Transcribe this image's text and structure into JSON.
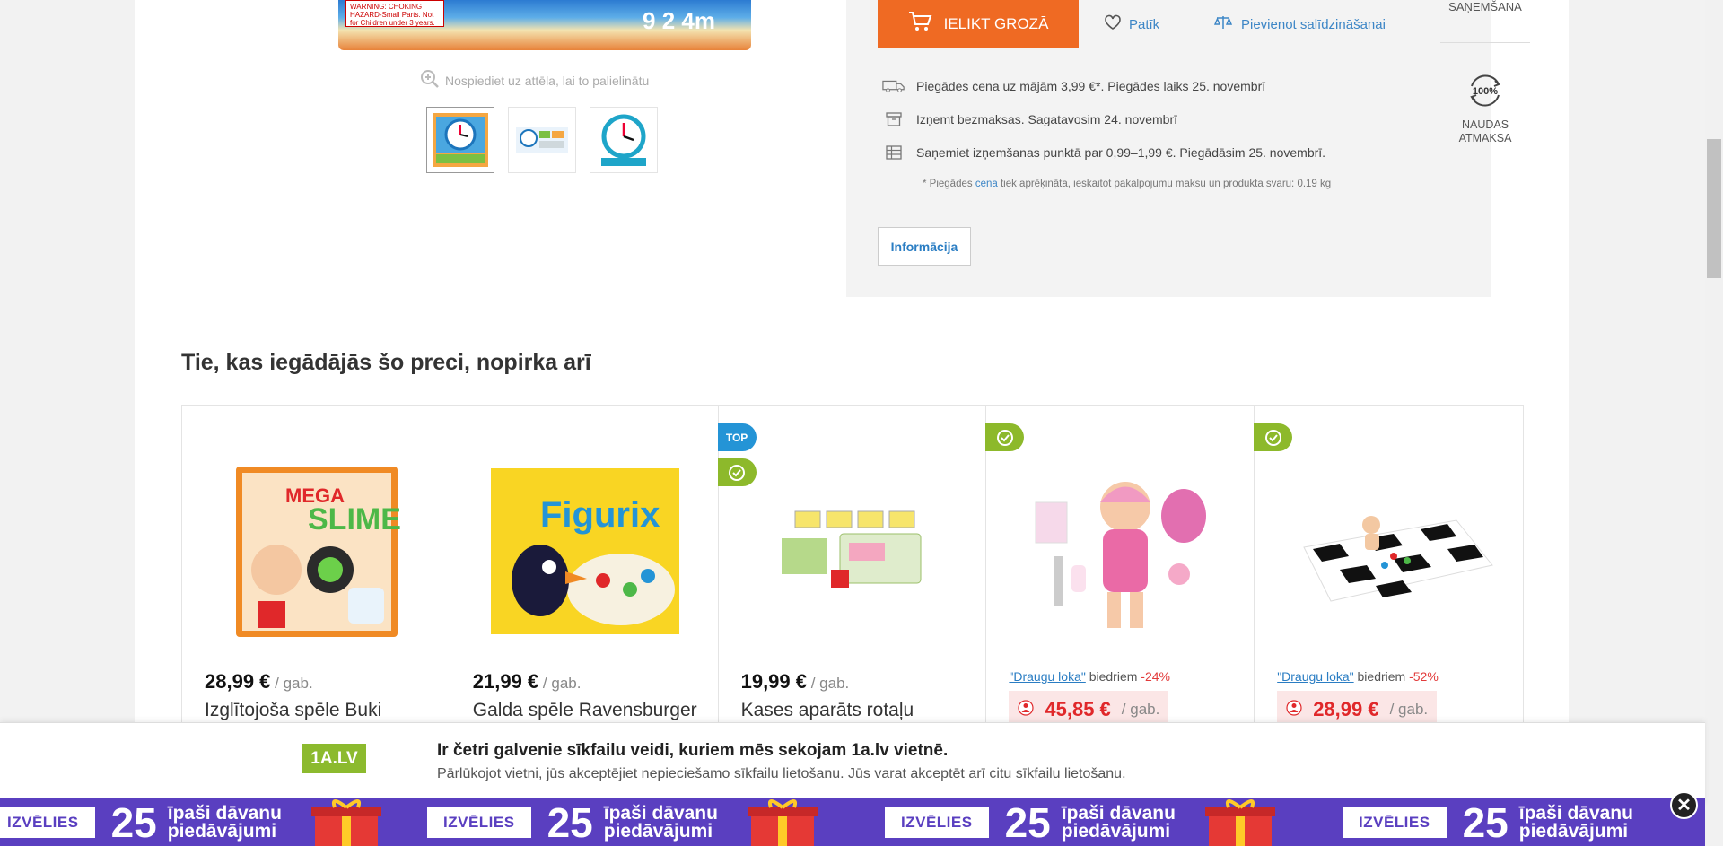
{
  "gallery": {
    "zoom_hint": "Nospiediet uz attēla, lai to palielinātu",
    "warning_text": "WARNING: CHOKING HAZARD-Small Parts. Not for Children under 3 years.",
    "numbers": "9 2 4m",
    "thumbnails": [
      "clock-box-front",
      "clock-box-contents",
      "clock-face"
    ]
  },
  "buy_box": {
    "cart_button": "IELIKT GROZĀ",
    "like_link": "Patīk",
    "compare_link": "Pievienot salīdzināšanai",
    "delivery": [
      {
        "icon": "truck-icon",
        "text": "Piegādes cena uz mājām 3,99 €*. Piegādes laiks 25. novembrī"
      },
      {
        "icon": "box-icon",
        "text": "Izņemt bezmaksas. Sagatavosim 24. novembrī"
      },
      {
        "icon": "parcel-locker-icon",
        "text": "Saņemiet izņemšanas punktā par 0,99–1,99 €. Piegādāsim 25. novembrī."
      }
    ],
    "note_prefix": "* Piegādes ",
    "note_link": "cena",
    "note_suffix": " tiek aprēķināta, ieskaitot pakalpojumu maksu un produkta svaru: 0.19 kg",
    "info_button": "Informācija"
  },
  "right_col": {
    "top_label": "SAŅEMŠANA",
    "refund_percent": "100%",
    "refund_line1": "NAUDAS",
    "refund_line2": "ATMAKSA"
  },
  "section": {
    "title": "Tie, kas iegādājās šo preci, nopirka arī"
  },
  "products": [
    {
      "price": "28,99 €",
      "unit": " / gab.",
      "name": "Izglītojoša spēle Buki",
      "badges": []
    },
    {
      "price": "21,99 €",
      "unit": " / gab.",
      "name": "Galda spēle Ravensburger",
      "badges": []
    },
    {
      "price": "19,99 €",
      "unit": " / gab.",
      "name": "Kases aparāts rotaļu",
      "badges": [
        "TOP",
        "check"
      ]
    },
    {
      "friends_link": "\"Draugu loka\"",
      "friends_text": " biedriem ",
      "discount": "-24%",
      "price": "45,85 €",
      "unit": " / gab.",
      "badges": [
        "check"
      ]
    },
    {
      "friends_link": "\"Draugu loka\"",
      "friends_text": " biedriem ",
      "discount": "-52%",
      "price": "28,99 €",
      "unit": " / gab.",
      "badges": [
        "check"
      ]
    }
  ],
  "cookie": {
    "logo": "1A.LV",
    "title": "Ir četri galvenie sīkfailu veidi, kuriem mēs sekojam 1a.lv vietnē.",
    "description": "Pārlūkojot vietni, jūs akceptējiet nepieciešamo sīkfailu lietošanu. Jūs varat akceptēt arī citu sīkfailu lietošanu."
  },
  "promo": {
    "chip": "IZVĒLIES",
    "number": "25",
    "title_line1": "īpaši dāvanu",
    "title_line2": "piedāvājumi",
    "close": "✕"
  },
  "colors": {
    "accent_orange": "#ef6a23",
    "link_blue": "#3d86c6",
    "promo_purple": "#5a3fc0",
    "badge_green": "#8db92b",
    "badge_blue": "#2494d6",
    "price_red": "#e0282a"
  }
}
